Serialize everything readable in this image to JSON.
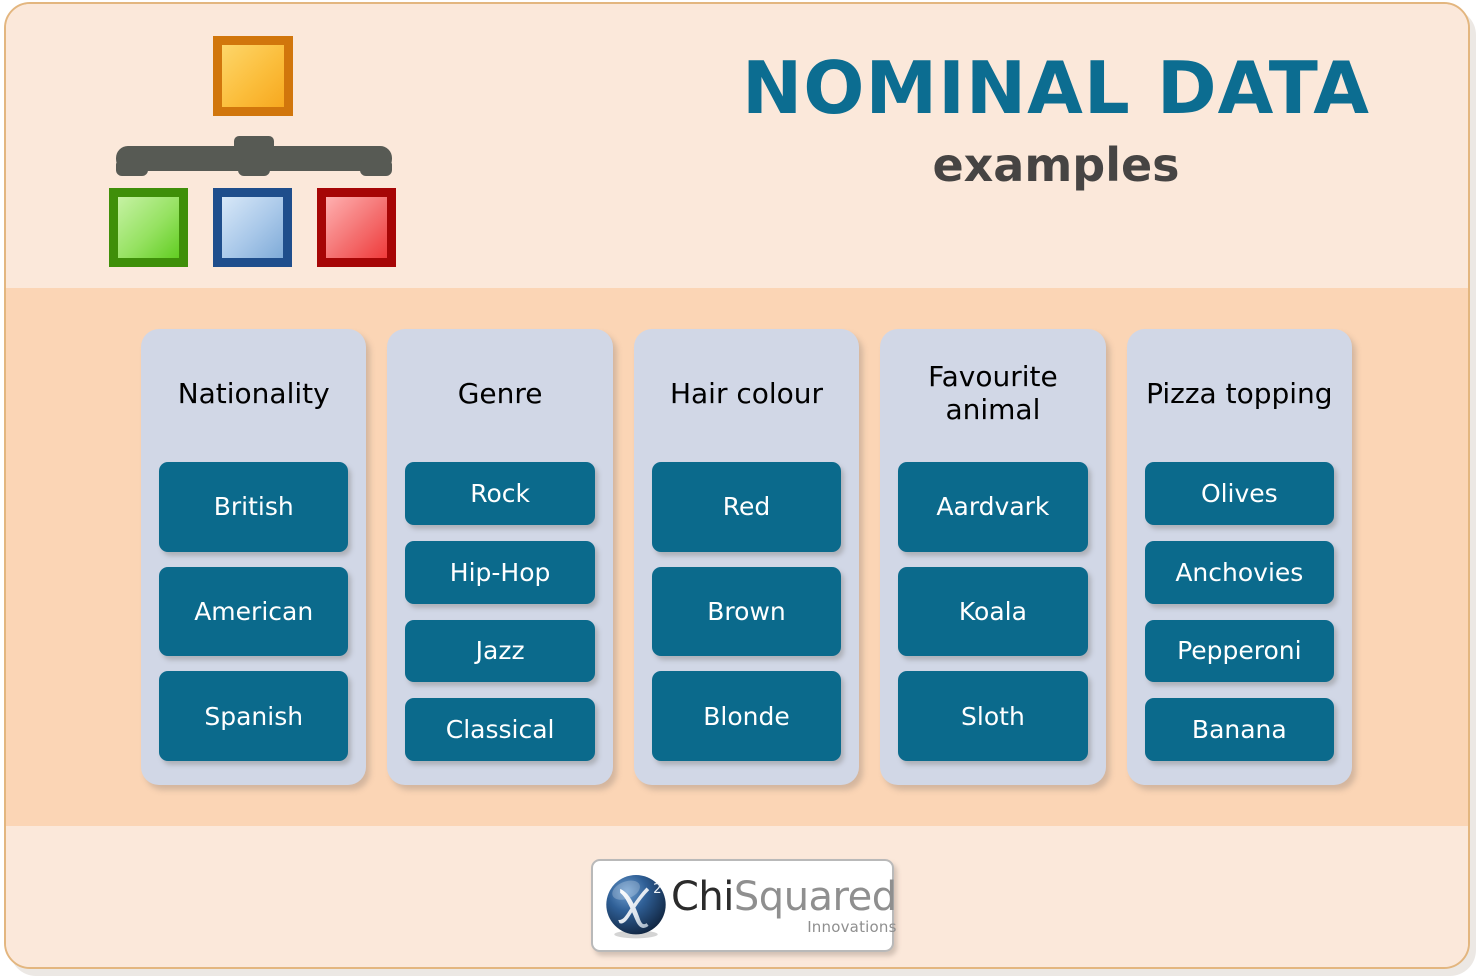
{
  "poster": {
    "header": {
      "title": "NOMINAL DATA",
      "subtitle": "examples",
      "title_color": "#0c6d91",
      "subtitle_color": "#464443",
      "icon_name": "hierarchy-icon",
      "icon_nodes": [
        {
          "name": "parent-node",
          "fill": "#f9b233",
          "border": "#d1760c"
        },
        {
          "name": "child-node-green",
          "fill": "#7ede4c",
          "border": "#3f8f09"
        },
        {
          "name": "child-node-blue",
          "fill": "#a8c6e8",
          "border": "#1f4e8c"
        },
        {
          "name": "child-node-red",
          "fill": "#f06a6a",
          "border": "#a60606"
        }
      ],
      "connector_color": "#575a54"
    },
    "background": {
      "band_top_color": "#fbe8da",
      "band_mid_color": "#fbd5b5",
      "band_bottom_color": "#fbe8da",
      "frame_border_color": "#e3b67f"
    },
    "card_color": "#d1d7e6",
    "pill_color": "#0b6a8c",
    "columns": [
      {
        "title": "Nationality",
        "items": [
          "British",
          "American",
          "Spanish"
        ]
      },
      {
        "title": "Genre",
        "items": [
          "Rock",
          "Hip-Hop",
          "Jazz",
          "Classical"
        ]
      },
      {
        "title": "Hair colour",
        "items": [
          "Red",
          "Brown",
          "Blonde"
        ]
      },
      {
        "title": "Favourite animal",
        "items": [
          "Aardvark",
          "Koala",
          "Sloth"
        ]
      },
      {
        "title": "Pizza topping",
        "items": [
          "Olives",
          "Anchovies",
          "Pepperoni",
          "Banana"
        ]
      }
    ],
    "logo": {
      "symbol": "chi-squared-sphere-icon",
      "name_part1": "Chi",
      "name_part2": "Squared",
      "tagline": "Innovations"
    }
  }
}
